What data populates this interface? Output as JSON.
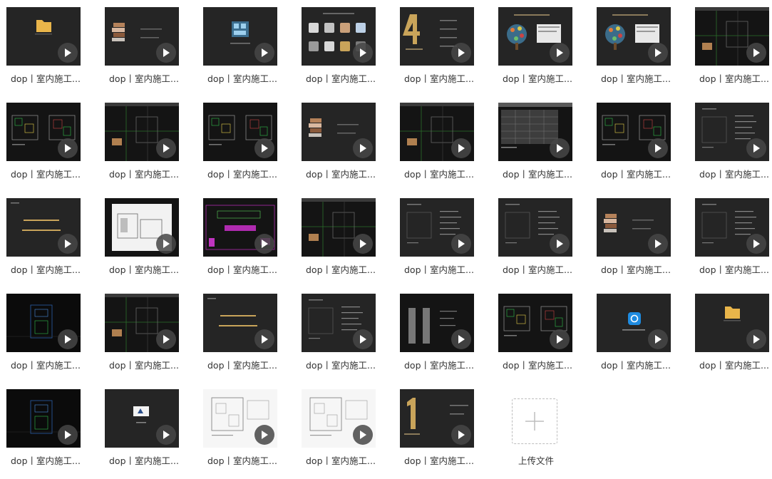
{
  "colors": {
    "thumb_dark": "#141414",
    "thumb_gray": "#252525",
    "thumb_white": "#f4f4f4",
    "play_bg": "#464646",
    "accent_gold": "#c9a45a",
    "cad_green": "#2fbf4a",
    "cad_yellow": "#e8d34a",
    "app_blue": "#1e8be0",
    "folder": "#e9b54a"
  },
  "files": [
    {
      "name": "dop丨室内施工...",
      "style": "folder"
    },
    {
      "name": "dop丨室内施工...",
      "style": "books"
    },
    {
      "name": "dop丨室内施工...",
      "style": "building"
    },
    {
      "name": "dop丨室内施工...",
      "style": "materials"
    },
    {
      "name": "dop丨室内施工...",
      "style": "big4"
    },
    {
      "name": "dop丨室内施工...",
      "style": "tree"
    },
    {
      "name": "dop丨室内施工...",
      "style": "tree"
    },
    {
      "name": "dop丨室内施工...",
      "style": "cad"
    },
    {
      "name": "dop丨室内施工...",
      "style": "cadplan"
    },
    {
      "name": "dop丨室内施工...",
      "style": "cad"
    },
    {
      "name": "dop丨室内施工...",
      "style": "cadplan"
    },
    {
      "name": "dop丨室内施工...",
      "style": "books"
    },
    {
      "name": "dop丨室内施工...",
      "style": "cad"
    },
    {
      "name": "dop丨室内施工...",
      "style": "cadgray"
    },
    {
      "name": "dop丨室内施工...",
      "style": "cadplan"
    },
    {
      "name": "dop丨室内施工...",
      "style": "textlist"
    },
    {
      "name": "dop丨室内施工...",
      "style": "slidetext"
    },
    {
      "name": "dop丨室内施工...",
      "style": "whitecad"
    },
    {
      "name": "dop丨室内施工...",
      "style": "magenta"
    },
    {
      "name": "dop丨室内施工...",
      "style": "cad"
    },
    {
      "name": "dop丨室内施工...",
      "style": "textlist"
    },
    {
      "name": "dop丨室内施工...",
      "style": "textlist"
    },
    {
      "name": "dop丨室内施工...",
      "style": "books"
    },
    {
      "name": "dop丨室内施工...",
      "style": "textlist"
    },
    {
      "name": "dop丨室内施工...",
      "style": "cadblue"
    },
    {
      "name": "dop丨室内施工...",
      "style": "cad"
    },
    {
      "name": "dop丨室内施工...",
      "style": "slidetext"
    },
    {
      "name": "dop丨室内施工...",
      "style": "textlist"
    },
    {
      "name": "dop丨室内施工...",
      "style": "cadcol"
    },
    {
      "name": "dop丨室内施工...",
      "style": "cadplan"
    },
    {
      "name": "dop丨室内施工...",
      "style": "appicon"
    },
    {
      "name": "dop丨室内施工...",
      "style": "folder"
    },
    {
      "name": "dop丨室内施工...",
      "style": "cadblue"
    },
    {
      "name": "dop丨室内施工...",
      "style": "logo"
    },
    {
      "name": "dop丨室内施工...",
      "style": "whiteplan"
    },
    {
      "name": "dop丨室内施工...",
      "style": "whiteplan"
    },
    {
      "name": "dop丨室内施工...",
      "style": "big1"
    }
  ],
  "upload": {
    "label": "上传文件"
  }
}
